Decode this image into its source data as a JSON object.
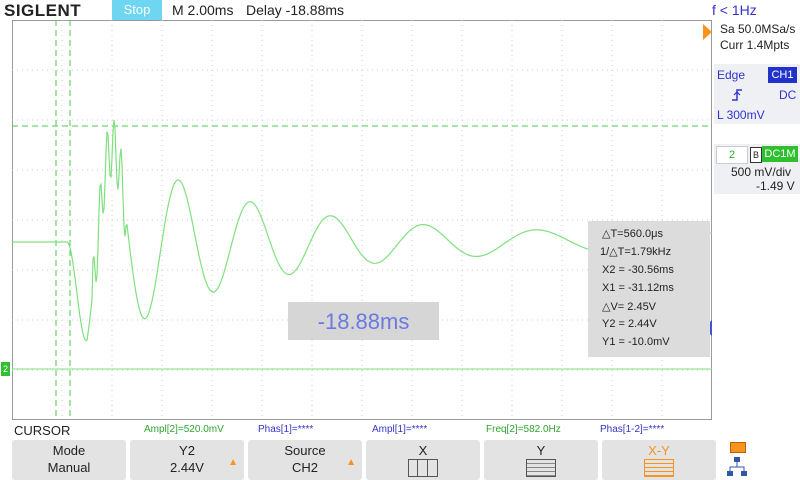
{
  "header": {
    "logo": "SIGLENT",
    "run_state": "Stop",
    "timebase": "M 2.00ms",
    "delay": "Delay -18.88ms",
    "freq_counter": "f < 1Hz"
  },
  "acquisition": {
    "sample_rate": "Sa 50.0MSa/s",
    "memory": "Curr 1.4Mpts"
  },
  "trigger": {
    "type": "Edge",
    "source": "CH1",
    "coupling": "DC",
    "level": "L  300mV"
  },
  "channel2": {
    "number": "2",
    "bw_icon": "B",
    "coupling": "DC1M",
    "scale": "500 mV/div",
    "offset": "-1.49 V"
  },
  "cursor_readout": {
    "delta_t": "△T=560.0μs",
    "inv_delta_t": "1/△T=1.79kHz",
    "x2": "X2 = -30.56ms",
    "x1": "X1 = -31.12ms",
    "delta_v": "△V= 2.45V",
    "y2": "Y2 = 2.44V",
    "y1": "Y1 = -10.0mV"
  },
  "delay_overlay": "-18.88ms",
  "bottom_info": {
    "title": "CURSOR",
    "ampl2": "Ampl[2]=520.0mV",
    "phas1": "Phas[1]=****",
    "ampl1": "Ampl[1]=****",
    "freq2": "Freq[2]=582.0Hz",
    "phas12": "Phas[1-2]=****"
  },
  "softkeys": [
    {
      "line1": "Mode",
      "line2": "Manual"
    },
    {
      "line1": "Y2",
      "line2": "2.44V"
    },
    {
      "line1": "Source",
      "line2": "CH2"
    },
    {
      "line1": "X",
      "line2": ""
    },
    {
      "line1": "Y",
      "line2": ""
    },
    {
      "line1": "X-Y",
      "line2": ""
    }
  ],
  "colors": {
    "trace": "#7fe07f",
    "cursor": "#4cc94c",
    "accent": "#f7941d",
    "blue": "#3333cc"
  }
}
